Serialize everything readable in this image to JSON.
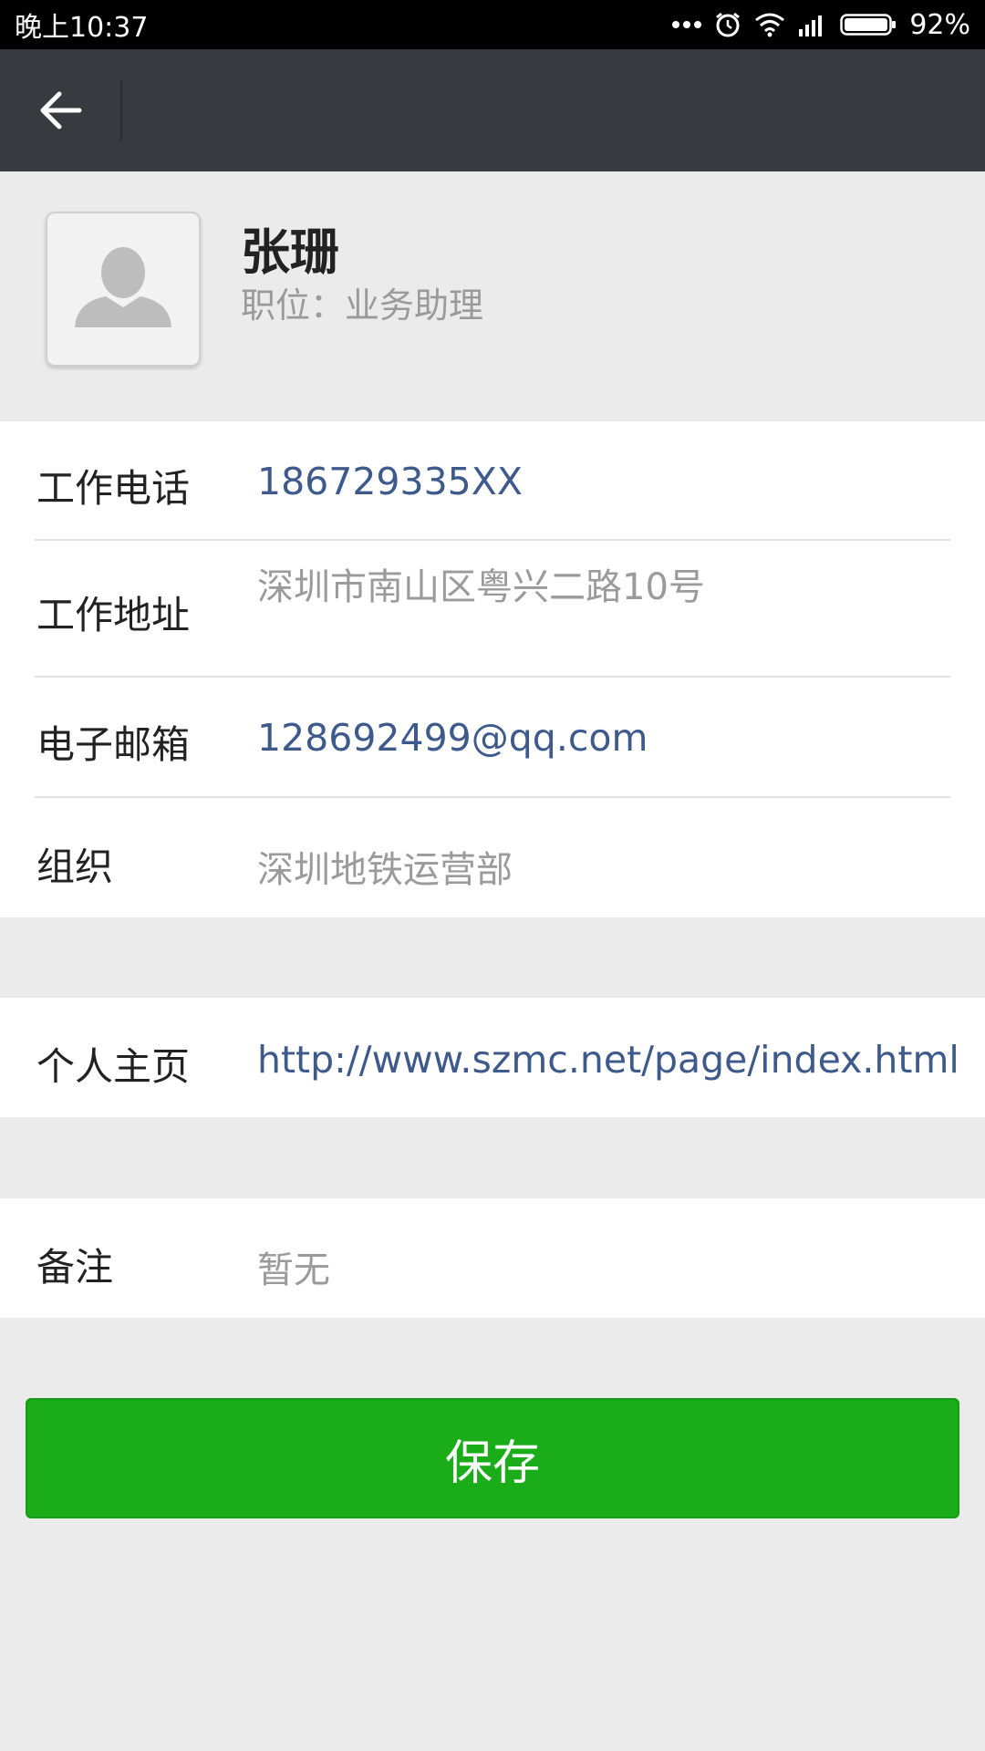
{
  "status_bar": {
    "time": "晚上10:37",
    "battery": "92%",
    "icons": [
      "more-dots-icon",
      "alarm-icon",
      "wifi-icon",
      "signal-icon",
      "battery-icon"
    ]
  },
  "nav": {
    "back_icon": "arrow-left-icon"
  },
  "profile": {
    "name": "张珊",
    "title": "职位：业务助理",
    "avatar_icon": "default-avatar-icon"
  },
  "info": {
    "phone_label": "工作电话",
    "phone_value": "186729335XX",
    "address_label": "工作地址",
    "address_value": "深圳市南山区粤兴二路10号",
    "email_label": "电子邮箱",
    "email_value": "128692499@qq.com",
    "org_label": "组织",
    "org_value": "深圳地铁运营部"
  },
  "homepage": {
    "label": "个人主页",
    "value": "http://www.szmc.net/page/index.html"
  },
  "note": {
    "label": "备注",
    "value": "暂无"
  },
  "actions": {
    "save_label": "保存"
  },
  "colors": {
    "nav_bg": "#393a3f",
    "link": "#3e5a8c",
    "primary_button": "#1aad19",
    "page_bg": "#ebebeb"
  }
}
